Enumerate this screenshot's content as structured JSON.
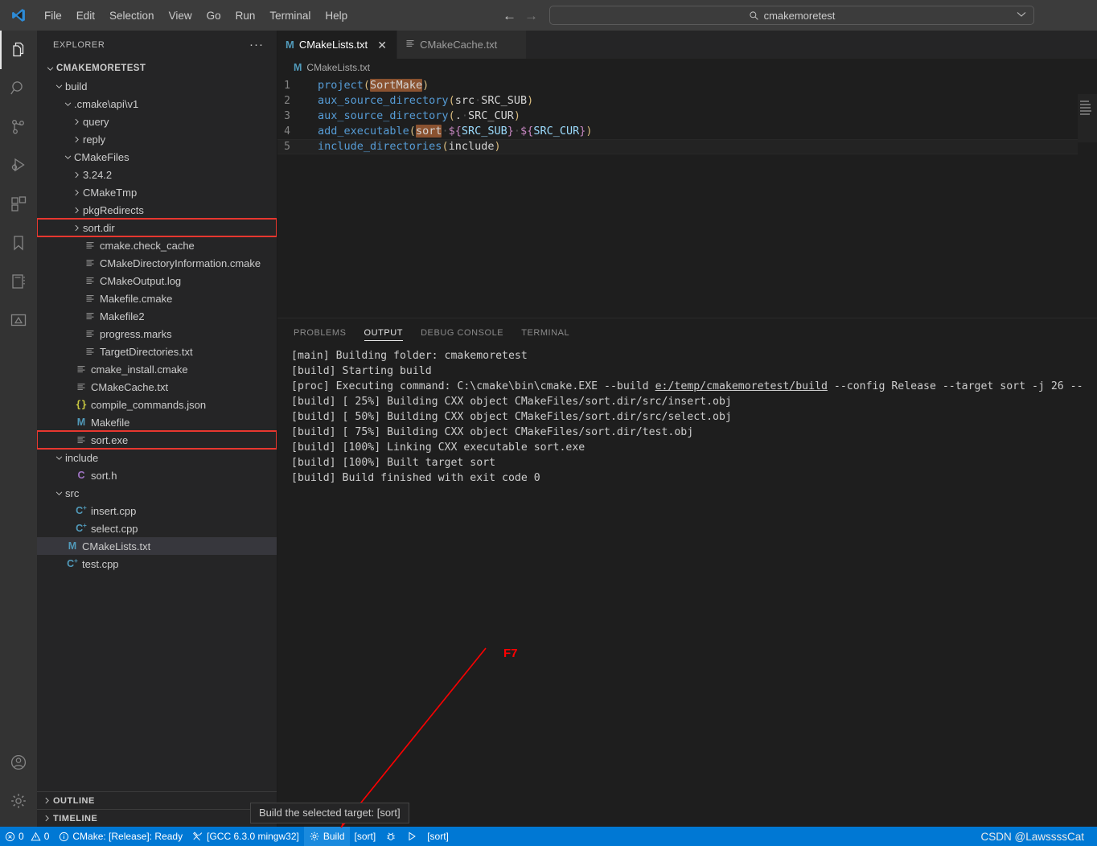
{
  "window": {
    "menu": [
      "File",
      "Edit",
      "Selection",
      "View",
      "Go",
      "Run",
      "Terminal",
      "Help"
    ],
    "command_center": {
      "value": "cmakemoretest",
      "icon": "search-icon"
    },
    "nav_back": "←",
    "nav_forward": "→",
    "chevron": "⌄"
  },
  "activitybar": {
    "items": [
      {
        "name": "explorer",
        "icon": "files-icon",
        "active": true
      },
      {
        "name": "search",
        "icon": "search-icon",
        "active": false
      },
      {
        "name": "source-control",
        "icon": "source-control-icon",
        "active": false
      },
      {
        "name": "run-and-debug",
        "icon": "run-debug-icon",
        "active": false
      },
      {
        "name": "extensions",
        "icon": "extensions-icon",
        "active": false
      },
      {
        "name": "bookmarks",
        "icon": "bookmark-icon",
        "active": false
      },
      {
        "name": "notebook",
        "icon": "notebook-icon",
        "active": false
      },
      {
        "name": "cmake-tools",
        "icon": "cmake-icon",
        "active": false
      }
    ],
    "bottom": [
      {
        "name": "accounts",
        "icon": "account-icon"
      },
      {
        "name": "settings",
        "icon": "gear-icon"
      }
    ]
  },
  "sidebar": {
    "title": "EXPLORER",
    "more_actions": "···",
    "tree": [
      {
        "label": "CMAKEMORETEST",
        "depth": 0,
        "kind": "root",
        "state": "expanded"
      },
      {
        "label": "build",
        "depth": 1,
        "kind": "folder",
        "state": "expanded"
      },
      {
        "label": ".cmake\\api\\v1",
        "depth": 2,
        "kind": "folder",
        "state": "expanded"
      },
      {
        "label": "query",
        "depth": 3,
        "kind": "folder",
        "state": "collapsed"
      },
      {
        "label": "reply",
        "depth": 3,
        "kind": "folder",
        "state": "collapsed"
      },
      {
        "label": "CMakeFiles",
        "depth": 2,
        "kind": "folder",
        "state": "expanded"
      },
      {
        "label": "3.24.2",
        "depth": 3,
        "kind": "folder",
        "state": "collapsed"
      },
      {
        "label": "CMakeTmp",
        "depth": 3,
        "kind": "folder",
        "state": "collapsed"
      },
      {
        "label": "pkgRedirects",
        "depth": 3,
        "kind": "folder",
        "state": "collapsed"
      },
      {
        "label": "sort.dir",
        "depth": 3,
        "kind": "folder",
        "state": "collapsed",
        "highlight": true
      },
      {
        "label": "cmake.check_cache",
        "depth": 3,
        "kind": "file-text"
      },
      {
        "label": "CMakeDirectoryInformation.cmake",
        "depth": 3,
        "kind": "file-text"
      },
      {
        "label": "CMakeOutput.log",
        "depth": 3,
        "kind": "file-text"
      },
      {
        "label": "Makefile.cmake",
        "depth": 3,
        "kind": "file-text"
      },
      {
        "label": "Makefile2",
        "depth": 3,
        "kind": "file-text"
      },
      {
        "label": "progress.marks",
        "depth": 3,
        "kind": "file-text"
      },
      {
        "label": "TargetDirectories.txt",
        "depth": 3,
        "kind": "file-text"
      },
      {
        "label": "cmake_install.cmake",
        "depth": 2,
        "kind": "file-text"
      },
      {
        "label": "CMakeCache.txt",
        "depth": 2,
        "kind": "file-text"
      },
      {
        "label": "compile_commands.json",
        "depth": 2,
        "kind": "file-json"
      },
      {
        "label": "Makefile",
        "depth": 2,
        "kind": "file-make"
      },
      {
        "label": "sort.exe",
        "depth": 2,
        "kind": "file-text",
        "highlight": true
      },
      {
        "label": "include",
        "depth": 1,
        "kind": "folder",
        "state": "expanded"
      },
      {
        "label": "sort.h",
        "depth": 2,
        "kind": "file-h"
      },
      {
        "label": "src",
        "depth": 1,
        "kind": "folder",
        "state": "expanded"
      },
      {
        "label": "insert.cpp",
        "depth": 2,
        "kind": "file-cpp"
      },
      {
        "label": "select.cpp",
        "depth": 2,
        "kind": "file-cpp"
      },
      {
        "label": "CMakeLists.txt",
        "depth": 1,
        "kind": "file-make",
        "selected": true
      },
      {
        "label": "test.cpp",
        "depth": 1,
        "kind": "file-cpp"
      }
    ],
    "sections": [
      {
        "label": "OUTLINE",
        "state": "collapsed"
      },
      {
        "label": "TIMELINE",
        "state": "collapsed"
      }
    ]
  },
  "editor": {
    "tabs": [
      {
        "label": "CMakeLists.txt",
        "icon": "makefile-icon",
        "active": true,
        "close": "✕"
      },
      {
        "label": "CMakeCache.txt",
        "icon": "text-file-icon",
        "active": false,
        "close": "✕"
      }
    ],
    "breadcrumb": {
      "icon": "makefile-icon",
      "label": "CMakeLists.txt"
    },
    "lines": [
      {
        "n": "1",
        "tokens": [
          {
            "t": "project",
            "c": "t-fn"
          },
          {
            "t": "(",
            "c": "t-paren"
          },
          {
            "t": "SortMake",
            "c": "t-plain hl-occ"
          },
          {
            "t": ")",
            "c": "t-paren"
          }
        ]
      },
      {
        "n": "2",
        "tokens": [
          {
            "t": "aux_source_directory",
            "c": "t-fn"
          },
          {
            "t": "(",
            "c": "t-paren"
          },
          {
            "t": "src",
            "c": "t-plain"
          },
          {
            "t": "·",
            "c": "t-dot"
          },
          {
            "t": "SRC_SUB",
            "c": "t-plain"
          },
          {
            "t": ")",
            "c": "t-paren"
          }
        ]
      },
      {
        "n": "3",
        "tokens": [
          {
            "t": "aux_source_directory",
            "c": "t-fn"
          },
          {
            "t": "(",
            "c": "t-paren"
          },
          {
            "t": ".",
            "c": "t-plain"
          },
          {
            "t": "·",
            "c": "t-dot"
          },
          {
            "t": "SRC_CUR",
            "c": "t-plain"
          },
          {
            "t": ")",
            "c": "t-paren"
          }
        ]
      },
      {
        "n": "4",
        "tokens": [
          {
            "t": "add_executable",
            "c": "t-fn"
          },
          {
            "t": "(",
            "c": "t-paren"
          },
          {
            "t": "sort",
            "c": "t-plain hl-occ"
          },
          {
            "t": "·",
            "c": "t-dot"
          },
          {
            "t": "${",
            "c": "t-var"
          },
          {
            "t": "SRC_SUB",
            "c": "t-id"
          },
          {
            "t": "}",
            "c": "t-var"
          },
          {
            "t": "·",
            "c": "t-dot"
          },
          {
            "t": "${",
            "c": "t-var"
          },
          {
            "t": "SRC_CUR",
            "c": "t-id"
          },
          {
            "t": "}",
            "c": "t-var"
          },
          {
            "t": ")",
            "c": "t-paren"
          }
        ]
      },
      {
        "n": "5",
        "current": true,
        "tokens": [
          {
            "t": "include_directories",
            "c": "t-fn"
          },
          {
            "t": "(",
            "c": "t-paren"
          },
          {
            "t": "include",
            "c": "t-plain"
          },
          {
            "t": ")",
            "c": "t-paren"
          }
        ]
      }
    ]
  },
  "panel": {
    "tabs": [
      {
        "label": "PROBLEMS",
        "active": false
      },
      {
        "label": "OUTPUT",
        "active": true
      },
      {
        "label": "DEBUG CONSOLE",
        "active": false
      },
      {
        "label": "TERMINAL",
        "active": false
      }
    ],
    "output": [
      [
        {
          "t": "[main] Building folder: cmakemoretest "
        }
      ],
      [
        {
          "t": "[build] Starting build"
        }
      ],
      [
        {
          "t": "[proc] Executing command: C:\\cmake\\bin\\cmake.EXE --build "
        },
        {
          "t": "e:/temp/cmakemoretest/build",
          "u": true
        },
        {
          "t": " --config Release --target sort -j 26 --"
        }
      ],
      [
        {
          "t": "[build] [ 25%] Building CXX object CMakeFiles/sort.dir/src/insert.obj"
        }
      ],
      [
        {
          "t": "[build] [ 50%] Building CXX object CMakeFiles/sort.dir/src/select.obj"
        }
      ],
      [
        {
          "t": "[build] [ 75%] Building CXX object CMakeFiles/sort.dir/test.obj"
        }
      ],
      [
        {
          "t": "[build] [100%] Linking CXX executable sort.exe"
        }
      ],
      [
        {
          "t": "[build] [100%] Built target sort"
        }
      ],
      [
        {
          "t": "[build] Build finished with exit code 0"
        }
      ]
    ]
  },
  "statusbar": {
    "errors": "0",
    "warnings": "0",
    "cmake_status": "CMake: [Release]: Ready",
    "kit": "[GCC 6.3.0 mingw32]",
    "build_label": "Build",
    "build_target": "[sort]",
    "debug_target": "[sort]",
    "watermark": "CSDN @LawssssCat",
    "accent": "#0078d4",
    "hover": "#1a8ade"
  },
  "annotation": {
    "tooltip": "Build the selected target: [sort]",
    "key_label": "F7",
    "color": "#ff0000"
  }
}
